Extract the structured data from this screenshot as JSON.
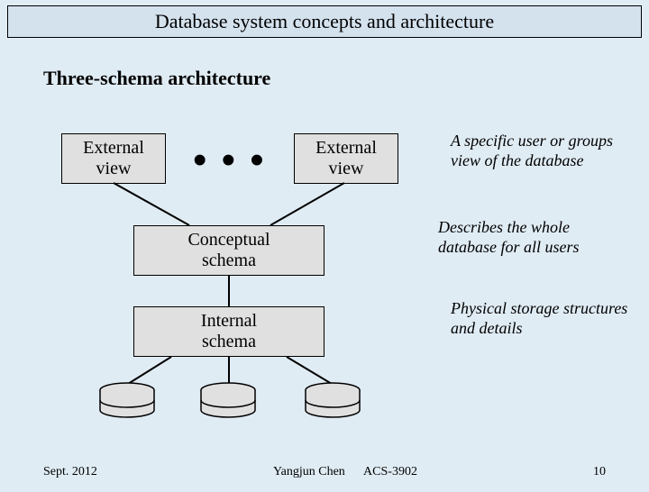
{
  "title": "Database system concepts and architecture",
  "subtitle": "Three-schema architecture",
  "boxes": {
    "external1": "External\nview",
    "external2": "External\nview",
    "conceptual": "Conceptual\nschema",
    "internal": "Internal\nschema"
  },
  "ellipsis": "• • •",
  "descriptions": {
    "external": "A specific user or groups view of the database",
    "conceptual": "Describes the whole database for all users",
    "internal": "Physical storage structures and details"
  },
  "footer": {
    "date": "Sept. 2012",
    "author": "Yangjun Chen",
    "course": "ACS-3902",
    "page": "10"
  }
}
